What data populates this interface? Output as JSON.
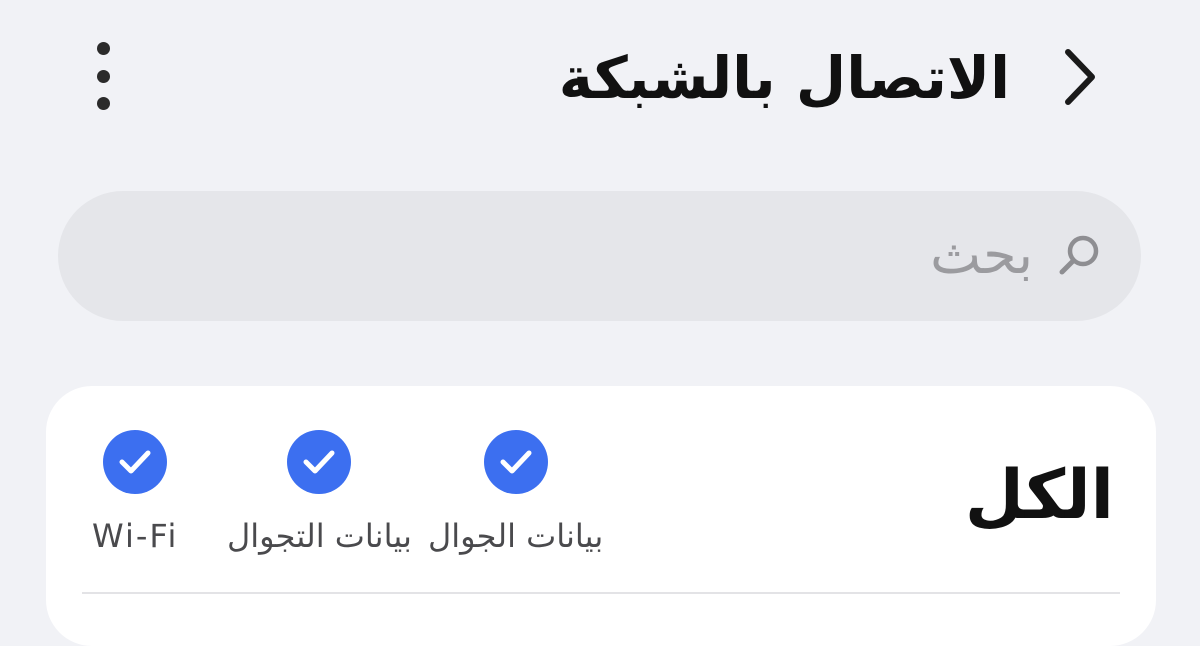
{
  "header": {
    "title": "الاتصال بالشبكة",
    "back_icon": "chevron-right-icon",
    "more_icon": "more-vertical-icon"
  },
  "search": {
    "placeholder": "بحث",
    "icon": "search-icon"
  },
  "filter_card": {
    "title": "الكل",
    "options": [
      {
        "label": "بيانات الجوال",
        "checked": true
      },
      {
        "label": "بيانات التجوال",
        "checked": true
      },
      {
        "label": "Wi-Fi",
        "checked": true
      }
    ]
  },
  "colors": {
    "background": "#f1f2f6",
    "search_bg": "#e5e6ea",
    "card_bg": "#ffffff",
    "accent": "#3c6ff0"
  }
}
